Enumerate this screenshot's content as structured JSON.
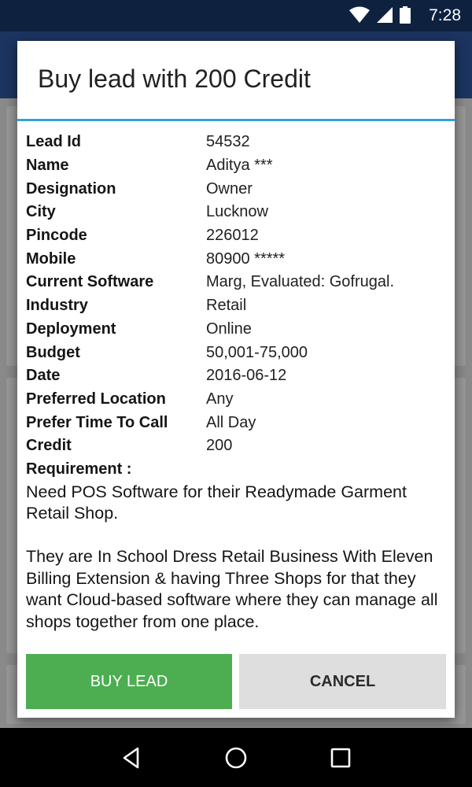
{
  "status_bar": {
    "time": "7:28",
    "icons": [
      "wifi-icon",
      "signal-icon",
      "battery-icon"
    ]
  },
  "dialog": {
    "title": "Buy lead with 200 Credit",
    "fields": [
      {
        "label": "Lead Id",
        "value": "54532"
      },
      {
        "label": "Name",
        "value": "Aditya ***"
      },
      {
        "label": "Designation",
        "value": "Owner"
      },
      {
        "label": "City",
        "value": "Lucknow"
      },
      {
        "label": "Pincode",
        "value": "226012"
      },
      {
        "label": "Mobile",
        "value": "80900 *****"
      },
      {
        "label": "Current Software",
        "value": "Marg, Evaluated: Gofrugal."
      },
      {
        "label": "Industry",
        "value": "Retail"
      },
      {
        "label": "Deployment",
        "value": "Online"
      },
      {
        "label": "Budget",
        "value": "50,001-75,000"
      },
      {
        "label": "Date",
        "value": "2016-06-12"
      },
      {
        "label": "Preferred Location",
        "value": "Any"
      },
      {
        "label": "Prefer Time To Call",
        "value": "All Day"
      },
      {
        "label": "Credit",
        "value": "200"
      }
    ],
    "requirement_label": "Requirement :",
    "requirement_text": "Need POS Software for their Readymade Garment Retail Shop.\n\nThey are In School Dress Retail Business With Eleven Billing Extension  & having Three Shops for that they want Cloud-based software where they can manage all shops together from one place.",
    "buy_label": "BUY LEAD",
    "cancel_label": "CANCEL"
  },
  "colors": {
    "accent": "#35a1d8",
    "buy": "#4cae50",
    "cancel": "#dedede",
    "status_bar": "#0e2240"
  },
  "nav": [
    "back-icon",
    "home-icon",
    "recents-icon"
  ]
}
